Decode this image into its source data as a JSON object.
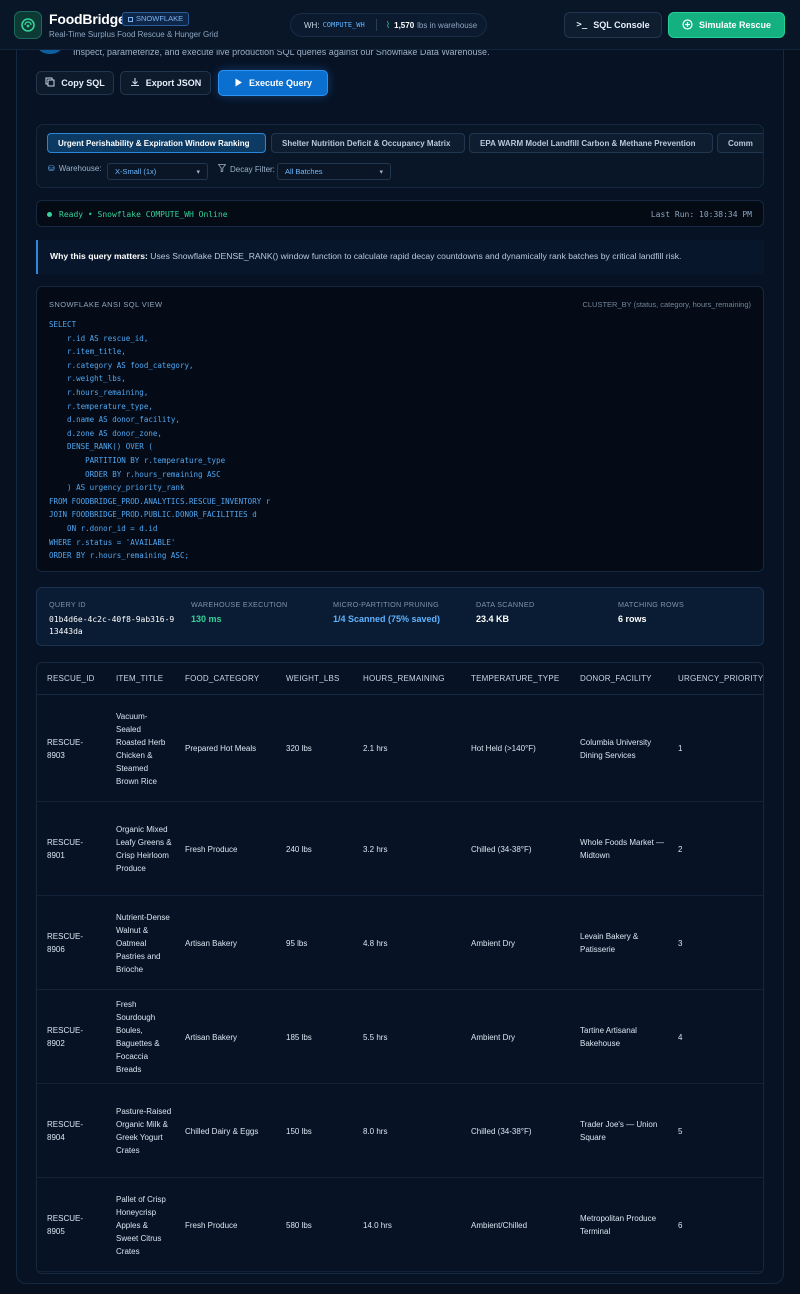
{
  "app": {
    "name": "FoodBridge",
    "badge": "SNOWFLAKE",
    "tagline": "Real-Time Surplus Food Rescue & Hunger Grid"
  },
  "header": {
    "wh_label": "WH:",
    "wh_name": "COMPUTE_WH",
    "lbs_count": "1,570",
    "lbs_label": "lbs in warehouse",
    "console_label": "SQL Console",
    "simulate_label": "Simulate Rescue"
  },
  "page": {
    "subtitle": "Inspect, parameterize, and execute live production SQL queries against our Snowflake Data Warehouse."
  },
  "actions": {
    "copy_label": "Copy SQL",
    "export_label": "Export JSON",
    "execute_label": "Execute Query"
  },
  "tabs": [
    {
      "label": "Urgent Perishability & Expiration Window Ranking"
    },
    {
      "label": "Shelter Nutrition Deficit & Occupancy Matrix"
    },
    {
      "label": "EPA WARM Model Landfill Carbon & Methane Prevention"
    },
    {
      "label": "Comm"
    }
  ],
  "filters": {
    "warehouse_label": "Warehouse:",
    "warehouse_value": "X-Small (1x)",
    "decay_label": "Decay Filter:",
    "decay_value": "All Batches"
  },
  "status": {
    "ready_text": "Ready • Snowflake COMPUTE_WH Online",
    "last_run": "Last Run: 10:38:34 PM"
  },
  "why": {
    "title": "Why this query matters:",
    "text": "Uses Snowflake DENSE_RANK() window function to calculate rapid decay countdowns and dynamically rank batches by critical landfill risk."
  },
  "sql": {
    "header": "SNOWFLAKE ANSI SQL VIEW",
    "cluster": "CLUSTER_BY (status, category, hours_remaining)",
    "code": "SELECT\n    r.id AS rescue_id,\n    r.item_title,\n    r.category AS food_category,\n    r.weight_lbs,\n    r.hours_remaining,\n    r.temperature_type,\n    d.name AS donor_facility,\n    d.zone AS donor_zone,\n    DENSE_RANK() OVER (\n        PARTITION BY r.temperature_type\n        ORDER BY r.hours_remaining ASC\n    ) AS urgency_priority_rank\nFROM FOODBRIDGE_PROD.ANALYTICS.RESCUE_INVENTORY r\nJOIN FOODBRIDGE_PROD.PUBLIC.DONOR_FACILITIES d\n    ON r.donor_id = d.id\nWHERE r.status = 'AVAILABLE'\nORDER BY r.hours_remaining ASC;"
  },
  "metrics": [
    {
      "label": "QUERY ID",
      "value": "01b4d6e-4c2c-40f8-9ab316-913443da"
    },
    {
      "label": "WAREHOUSE EXECUTION",
      "value": "130 ms"
    },
    {
      "label": "MICRO-PARTITION PRUNING",
      "value": "1/4 Scanned (75% saved)"
    },
    {
      "label": "DATA SCANNED",
      "value": "23.4 KB"
    },
    {
      "label": "MATCHING ROWS",
      "value": "6 rows"
    }
  ],
  "table": {
    "columns": [
      "RESCUE_ID",
      "ITEM_TITLE",
      "FOOD_CATEGORY",
      "WEIGHT_LBS",
      "HOURS_REMAINING",
      "TEMPERATURE_TYPE",
      "DONOR_FACILITY",
      "URGENCY_PRIORITY"
    ],
    "rows": [
      {
        "id": "RESCUE-8903",
        "item": "Vacuum-Sealed Roasted Herb Chicken & Steamed Brown Rice",
        "category": "Prepared Hot Meals",
        "weight": "320 lbs",
        "hours": "2.1 hrs",
        "temp": "Hot Held (>140°F)",
        "donor": "Columbia University Dining Services",
        "rank": "1"
      },
      {
        "id": "RESCUE-8901",
        "item": "Organic Mixed Leafy Greens & Crisp Heirloom Produce",
        "category": "Fresh Produce",
        "weight": "240 lbs",
        "hours": "3.2 hrs",
        "temp": "Chilled (34-38°F)",
        "donor": "Whole Foods Market — Midtown",
        "rank": "2"
      },
      {
        "id": "RESCUE-8906",
        "item": "Nutrient-Dense Walnut & Oatmeal Pastries and Brioche",
        "category": "Artisan Bakery",
        "weight": "95 lbs",
        "hours": "4.8 hrs",
        "temp": "Ambient Dry",
        "donor": "Levain Bakery & Patisserie",
        "rank": "3"
      },
      {
        "id": "RESCUE-8902",
        "item": "Fresh Sourdough Boules, Baguettes & Focaccia Breads",
        "category": "Artisan Bakery",
        "weight": "185 lbs",
        "hours": "5.5 hrs",
        "temp": "Ambient Dry",
        "donor": "Tartine Artisanal Bakehouse",
        "rank": "4"
      },
      {
        "id": "RESCUE-8904",
        "item": "Pasture-Raised Organic Milk & Greek Yogurt Crates",
        "category": "Chilled Dairy & Eggs",
        "weight": "150 lbs",
        "hours": "8.0 hrs",
        "temp": "Chilled (34-38°F)",
        "donor": "Trader Joe's — Union Square",
        "rank": "5"
      },
      {
        "id": "RESCUE-8905",
        "item": "Pallet of Crisp Honeycrisp Apples & Sweet Citrus Crates",
        "category": "Fresh Produce",
        "weight": "580 lbs",
        "hours": "14.0 hrs",
        "temp": "Ambient/Chilled",
        "donor": "Metropolitan Produce Terminal",
        "rank": "6"
      }
    ]
  },
  "colors": {
    "background": "#06101f",
    "accent_blue": "#0b6fd0",
    "accent_green": "#14b07f",
    "status_green": "#34d399"
  }
}
